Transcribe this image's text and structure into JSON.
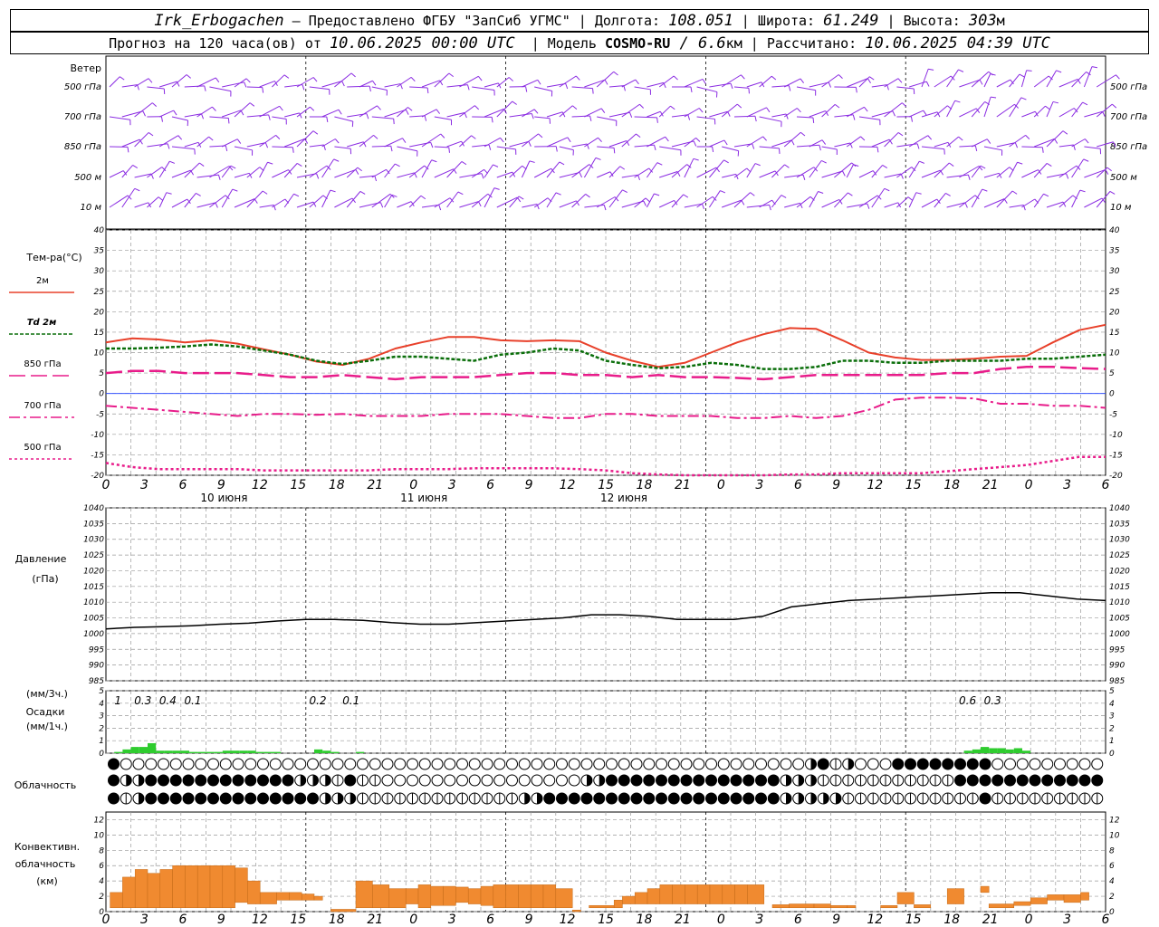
{
  "header": {
    "line1": {
      "station": "Irk_Erbogachen",
      "dash": " – ",
      "provider": "Предоставлено ФГБУ \"ЗапСиб УГМС\"",
      "sep": " | ",
      "lon_label": "Долгота: ",
      "lon_value": "108.051",
      "lat_label": "Широта: ",
      "lat_value": "61.249",
      "alt_label": "Высота: ",
      "alt_value": "303",
      "alt_unit": "м"
    },
    "line2": {
      "forecast_label": "Прогноз на 120 часа(ов) от ",
      "forecast_from": "10.06.2025 00:00 UTC",
      "model_sep": "  | Модель ",
      "model_name": "COSMO-RU",
      "model_res_prefix": " / ",
      "model_res": "6.6",
      "model_res_unit": "км",
      "calc_sep": " | Рассчитано: ",
      "calc_time": "10.06.2025 04:39 UTC"
    }
  },
  "chart_data": {
    "time_axis": {
      "start": "10.06.2025 00:00 UTC",
      "step_hours": 3,
      "tick_labels": [
        "0",
        "3",
        "6",
        "9",
        "12",
        "15",
        "18",
        "21",
        "0",
        "3",
        "6",
        "9",
        "12",
        "15",
        "18",
        "21",
        "0",
        "3",
        "6",
        "9",
        "12",
        "15",
        "18",
        "21",
        "0",
        "3",
        "6"
      ],
      "day_labels": [
        "10 июня",
        "11 июня",
        "12 июня"
      ]
    },
    "wind": {
      "title": "Ветер",
      "levels": [
        "500 гПа",
        "700 гПа",
        "850 гПа",
        "500 м",
        "10  м"
      ],
      "color": "#8a2be2"
    },
    "temperature": {
      "type": "line",
      "ylabel": "Тем-ра(°С)",
      "ylim": [
        -20,
        40
      ],
      "yticks": [
        -20,
        -15,
        -10,
        -5,
        0,
        5,
        10,
        15,
        20,
        25,
        30,
        35,
        40
      ],
      "series": [
        {
          "name": "2м",
          "color": "#e8402a",
          "dash": "",
          "width": 2,
          "values": [
            12.5,
            13.5,
            13.2,
            12.5,
            13,
            12.2,
            10.8,
            9.5,
            7.8,
            7,
            8.5,
            11,
            12.5,
            13.8,
            13.8,
            13,
            12.8,
            13,
            12.8,
            10,
            8,
            6.5,
            7.5,
            10,
            12.5,
            14.5,
            16,
            15.8,
            13,
            10,
            8.8,
            8.2,
            8.2,
            8.5,
            9,
            9.2,
            12.5,
            15.5,
            16.8
          ]
        },
        {
          "name": "Td 2м",
          "color": "#0a6e0a",
          "dash": "4,2",
          "width": 2.5,
          "values": [
            11,
            11,
            11.2,
            11.5,
            12,
            11.5,
            10.5,
            9.5,
            8,
            7.2,
            8,
            9,
            9,
            8.5,
            8,
            9.5,
            10,
            11,
            10.5,
            8,
            7,
            6.2,
            6.5,
            7.5,
            7,
            6,
            6,
            6.5,
            8,
            8,
            7.5,
            7.5,
            8,
            8,
            8,
            8.5,
            8.5,
            9,
            9.5
          ]
        },
        {
          "name": "850 гПа",
          "color": "#e81c8a",
          "dash": "18,6",
          "width": 2.5,
          "values": [
            5,
            5.5,
            5.5,
            5,
            5,
            5,
            4.5,
            4,
            4,
            4.5,
            4,
            3.5,
            4,
            4,
            4,
            4.5,
            5,
            5,
            4.5,
            4.5,
            4,
            4.5,
            4,
            4,
            3.8,
            3.5,
            4,
            4.5,
            4.5,
            4.5,
            4.5,
            4.5,
            5,
            5,
            6,
            6.5,
            6.5,
            6.2,
            6
          ]
        },
        {
          "name": "700 гПа",
          "color": "#e81c8a",
          "dash": "12,4,3,4",
          "width": 2,
          "values": [
            -3,
            -3.5,
            -4,
            -4.5,
            -5,
            -5.5,
            -5,
            -5,
            -5.2,
            -5,
            -5.5,
            -5.5,
            -5.5,
            -5,
            -5,
            -5,
            -5.5,
            -6,
            -6,
            -5,
            -5,
            -5.5,
            -5.5,
            -5.5,
            -6,
            -6,
            -5.5,
            -6,
            -5.5,
            -4,
            -1.5,
            -1,
            -1,
            -1.2,
            -2.5,
            -2.5,
            -3,
            -3,
            -3.5
          ]
        },
        {
          "name": "500 гПа",
          "color": "#e81c8a",
          "dash": "3,3",
          "width": 2.5,
          "values": [
            -17,
            -18,
            -18.5,
            -18.5,
            -18.5,
            -18.5,
            -18.8,
            -18.8,
            -18.8,
            -18.8,
            -18.8,
            -18.5,
            -18.5,
            -18.5,
            -18.3,
            -18.3,
            -18.3,
            -18.3,
            -18.5,
            -18.8,
            -19.5,
            -19.8,
            -20,
            -20,
            -20,
            -20,
            -19.8,
            -19.8,
            -19.5,
            -19.5,
            -19.5,
            -19.5,
            -19,
            -18.5,
            -18,
            -17.5,
            -16.5,
            -15.5,
            -15.5
          ]
        }
      ]
    },
    "pressure": {
      "type": "line",
      "ylabel": [
        "Давление",
        "(гПа)"
      ],
      "ylim": [
        985,
        1040
      ],
      "yticks": [
        985,
        990,
        995,
        1000,
        1005,
        1010,
        1015,
        1020,
        1025,
        1030,
        1035,
        1040
      ],
      "values": [
        1001.5,
        1002,
        1002.2,
        1002.5,
        1003,
        1003.3,
        1004,
        1004.5,
        1004.5,
        1004.2,
        1003.5,
        1003,
        1003,
        1003.5,
        1004,
        1004.5,
        1005,
        1006,
        1006,
        1005.5,
        1004.5,
        1004.5,
        1004.5,
        1005.5,
        1008.5,
        1009.5,
        1010.5,
        1011,
        1011.5,
        1012,
        1012.5,
        1013,
        1013,
        1012,
        1011,
        1010.5
      ]
    },
    "precipitation": {
      "type": "bar",
      "ylabel": [
        "(мм/3ч.)",
        "Осадки",
        "(мм/1ч.)"
      ],
      "ylim": [
        0,
        5
      ],
      "yticks": [
        0,
        1,
        2,
        3,
        4,
        5
      ],
      "totals": [
        {
          "t": 1,
          "label": "1"
        },
        {
          "t": 4,
          "label": "0.3"
        },
        {
          "t": 7,
          "label": "0.4"
        },
        {
          "t": 10,
          "label": "0.1"
        },
        {
          "t": 25,
          "label": "0.2"
        },
        {
          "t": 29,
          "label": "0.1"
        },
        {
          "t": 103,
          "label": "0.6"
        },
        {
          "t": 106,
          "label": "0.3"
        }
      ],
      "hourly": [
        0,
        0.1,
        0.3,
        0.5,
        0.5,
        0.8,
        0.2,
        0.2,
        0.2,
        0.2,
        0.1,
        0.1,
        0.1,
        0.1,
        0.2,
        0.2,
        0.2,
        0.2,
        0.1,
        0.1,
        0.1,
        0,
        0,
        0,
        0,
        0.3,
        0.2,
        0.1,
        0,
        0,
        0.1,
        0,
        0,
        0,
        0,
        0,
        0,
        0,
        0,
        0,
        0,
        0,
        0,
        0,
        0,
        0,
        0,
        0,
        0,
        0,
        0,
        0,
        0,
        0,
        0,
        0,
        0,
        0,
        0,
        0,
        0,
        0,
        0,
        0,
        0,
        0,
        0,
        0,
        0,
        0,
        0,
        0,
        0,
        0,
        0,
        0,
        0,
        0,
        0,
        0,
        0,
        0,
        0,
        0,
        0,
        0,
        0,
        0,
        0,
        0,
        0,
        0,
        0,
        0,
        0,
        0,
        0,
        0,
        0,
        0,
        0,
        0,
        0,
        0.2,
        0.3,
        0.5,
        0.4,
        0.4,
        0.3,
        0.4,
        0.2,
        0,
        0,
        0,
        0,
        0,
        0,
        0,
        0
      ],
      "color": "#2ecc2e"
    },
    "cloudiness": {
      "label": "Облачность",
      "rows": [
        "FEEEEEEEEEEEEEEEEEEEEEEEEEEEEEEEEEEEEEEEEEEEEEEEEEEEEEEEHFLHEEEFFFFFFFFEEEEEEEEEEEEEEEEEEEEHHLLEFFFFEEEEEEEEEEEEEEEEEEEEEEFFFFFFEEEHHHHFFFFF",
        "FHHFFFFFFFFFFFFHHHLFLLEEEEEEEEEEEEEEEEHHFFFFFFFFFFFFFFHHHLLLLLLLLLLLFFFFFFFFFFFFFFFFFFFHHLLLEEEEEEEEEEEEEEFFFFFFFFFFFLLLLLLEEEHHHHLLLLEEE",
        "FLHFFFFFFFFFFFFFFHHHLLLLLLLLLLLLLHHFFFFFFFFFFFFFFFFFFFHHHHHLLLLLLLLLLLFLLLLLLLLLLLHHHHHHHHHHHHFFFFFFFFFFFFFFFFFFFFFFFFFFFFLLLLLLLLLLLLLLLLL"
      ]
    },
    "convective": {
      "type": "bar",
      "ylabel": [
        "Конвективн.",
        "облачность",
        "(км)"
      ],
      "ylim": [
        0,
        13
      ],
      "yticks": [
        0,
        2,
        4,
        6,
        8,
        10,
        12
      ],
      "color": "#f08a30",
      "blocks": [
        {
          "t0": 0.5,
          "t1": 2,
          "b": 0.5,
          "h": 2
        },
        {
          "t0": 2,
          "t1": 3.5,
          "b": 0.5,
          "h": 4
        },
        {
          "t0": 3.5,
          "t1": 5,
          "b": 0.5,
          "h": 5
        },
        {
          "t0": 5,
          "t1": 6.5,
          "b": 0.5,
          "h": 4.5
        },
        {
          "t0": 6.5,
          "t1": 8,
          "b": 0.5,
          "h": 5
        },
        {
          "t0": 8,
          "t1": 9.5,
          "b": 0.5,
          "h": 5.5
        },
        {
          "t0": 9.5,
          "t1": 11,
          "b": 0.5,
          "h": 5.5
        },
        {
          "t0": 11,
          "t1": 12.5,
          "b": 0.5,
          "h": 5.5
        },
        {
          "t0": 12.5,
          "t1": 14,
          "b": 0.5,
          "h": 5.5
        },
        {
          "t0": 14,
          "t1": 15.5,
          "b": 0.5,
          "h": 5.5
        },
        {
          "t0": 15.5,
          "t1": 17,
          "b": 1.2,
          "h": 4.5
        },
        {
          "t0": 17,
          "t1": 18.5,
          "b": 1,
          "h": 3
        },
        {
          "t0": 18.5,
          "t1": 20.5,
          "b": 1,
          "h": 1.5
        },
        {
          "t0": 20.5,
          "t1": 22,
          "b": 1.5,
          "h": 1
        },
        {
          "t0": 22,
          "t1": 23.5,
          "b": 1.5,
          "h": 1
        },
        {
          "t0": 23.5,
          "t1": 25,
          "b": 1.5,
          "h": 0.8
        },
        {
          "t0": 25,
          "t1": 26,
          "b": 1.5,
          "h": 0.5
        },
        {
          "t0": 27,
          "t1": 30,
          "b": 0,
          "h": 0.3
        },
        {
          "t0": 30,
          "t1": 32,
          "b": 0.5,
          "h": 3.5
        },
        {
          "t0": 32,
          "t1": 34,
          "b": 0.5,
          "h": 3
        },
        {
          "t0": 34,
          "t1": 36,
          "b": 0.5,
          "h": 2.5
        },
        {
          "t0": 36,
          "t1": 37.5,
          "b": 1,
          "h": 2
        },
        {
          "t0": 37.5,
          "t1": 39,
          "b": 0.5,
          "h": 3
        },
        {
          "t0": 39,
          "t1": 40.5,
          "b": 0.8,
          "h": 2.5
        },
        {
          "t0": 40.5,
          "t1": 42,
          "b": 0.8,
          "h": 2.5
        },
        {
          "t0": 42,
          "t1": 43.5,
          "b": 1.2,
          "h": 2
        },
        {
          "t0": 43.5,
          "t1": 45,
          "b": 1,
          "h": 2
        },
        {
          "t0": 45,
          "t1": 46.5,
          "b": 0.8,
          "h": 2.5
        },
        {
          "t0": 46.5,
          "t1": 48,
          "b": 0.5,
          "h": 3
        },
        {
          "t0": 48,
          "t1": 49.5,
          "b": 0.5,
          "h": 3
        },
        {
          "t0": 49.5,
          "t1": 51,
          "b": 0.5,
          "h": 3
        },
        {
          "t0": 51,
          "t1": 52.5,
          "b": 0.5,
          "h": 3
        },
        {
          "t0": 52.5,
          "t1": 54,
          "b": 0.5,
          "h": 3
        },
        {
          "t0": 54,
          "t1": 56,
          "b": 0.5,
          "h": 2.5
        },
        {
          "t0": 56,
          "t1": 57,
          "b": 0,
          "h": 0.2
        },
        {
          "t0": 58,
          "t1": 61,
          "b": 0.5,
          "h": 0.3
        },
        {
          "t0": 61,
          "t1": 62,
          "b": 0.5,
          "h": 1
        },
        {
          "t0": 62,
          "t1": 63.5,
          "b": 1,
          "h": 1
        },
        {
          "t0": 63.5,
          "t1": 65,
          "b": 1,
          "h": 1.5
        },
        {
          "t0": 65,
          "t1": 66.5,
          "b": 1,
          "h": 2
        },
        {
          "t0": 66.5,
          "t1": 68,
          "b": 1,
          "h": 2.5
        },
        {
          "t0": 68,
          "t1": 69.5,
          "b": 1,
          "h": 2.5
        },
        {
          "t0": 69.5,
          "t1": 71,
          "b": 1,
          "h": 2.5
        },
        {
          "t0": 71,
          "t1": 72.5,
          "b": 1,
          "h": 2.5
        },
        {
          "t0": 72.5,
          "t1": 74,
          "b": 1,
          "h": 2.5
        },
        {
          "t0": 74,
          "t1": 75.5,
          "b": 1,
          "h": 2.5
        },
        {
          "t0": 75.5,
          "t1": 77,
          "b": 1,
          "h": 2.5
        },
        {
          "t0": 77,
          "t1": 79,
          "b": 1,
          "h": 2.5
        },
        {
          "t0": 80,
          "t1": 82,
          "b": 0.5,
          "h": 0.4
        },
        {
          "t0": 82,
          "t1": 85,
          "b": 0.5,
          "h": 0.5
        },
        {
          "t0": 85,
          "t1": 87,
          "b": 0.5,
          "h": 0.5
        },
        {
          "t0": 87,
          "t1": 89,
          "b": 0.5,
          "h": 0.3
        },
        {
          "t0": 89,
          "t1": 90,
          "b": 0.5,
          "h": 0.3
        },
        {
          "t0": 93,
          "t1": 95,
          "b": 0.5,
          "h": 0.3
        },
        {
          "t0": 95,
          "t1": 97,
          "b": 1,
          "h": 1.5
        },
        {
          "t0": 97,
          "t1": 99,
          "b": 0.5,
          "h": 0.4
        },
        {
          "t0": 101,
          "t1": 103,
          "b": 1,
          "h": 2
        },
        {
          "t0": 105,
          "t1": 106,
          "b": 2.5,
          "h": 0.8
        },
        {
          "t0": 106,
          "t1": 109,
          "b": 0.5,
          "h": 0.5
        },
        {
          "t0": 109,
          "t1": 111,
          "b": 0.8,
          "h": 0.5
        },
        {
          "t0": 111,
          "t1": 113,
          "b": 1,
          "h": 0.8
        },
        {
          "t0": 113,
          "t1": 115,
          "b": 1.5,
          "h": 0.7
        },
        {
          "t0": 115,
          "t1": 117,
          "b": 1.2,
          "h": 1
        },
        {
          "t0": 117,
          "t1": 118,
          "b": 1.5,
          "h": 1
        }
      ]
    }
  }
}
